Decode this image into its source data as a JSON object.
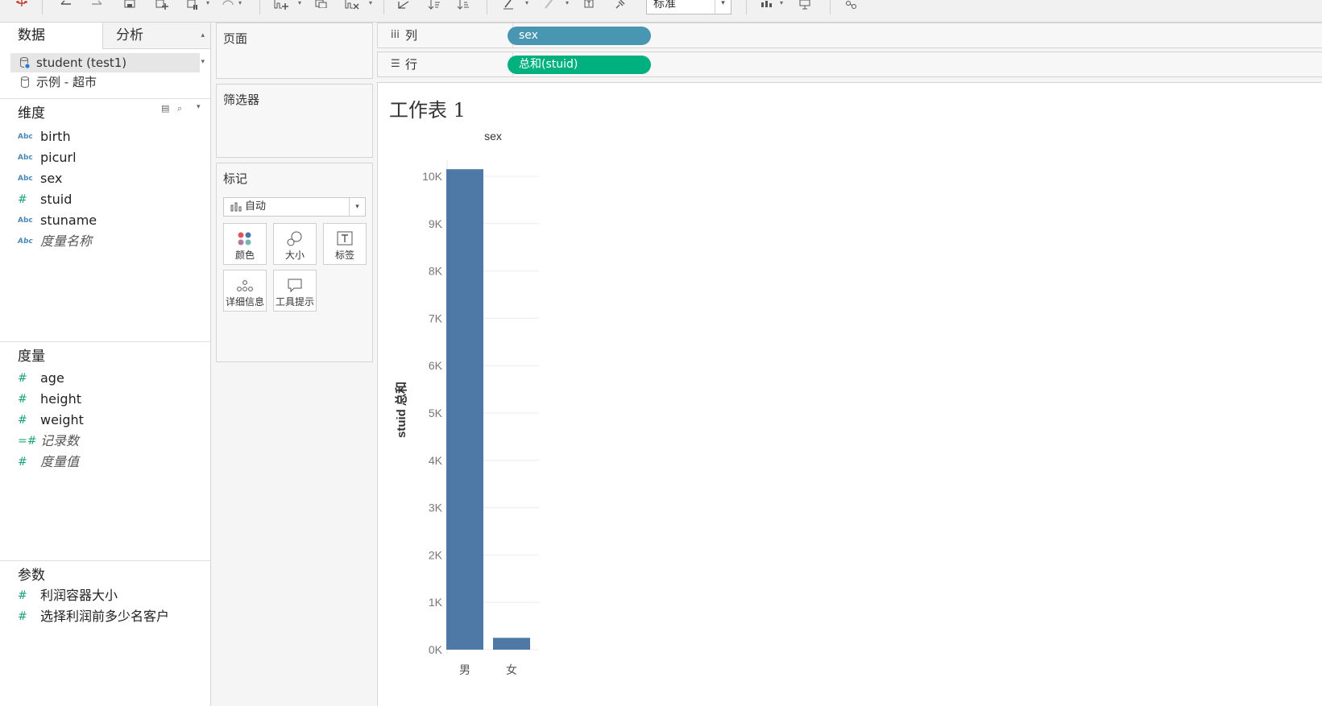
{
  "toolbar": {
    "fit_value": "标准"
  },
  "data_pane": {
    "tabs": [
      {
        "label": "数据"
      },
      {
        "label": "分析"
      }
    ],
    "data_sources": [
      {
        "label": "student (test1)",
        "selected": true
      },
      {
        "label": "示例 - 超市",
        "selected": false
      }
    ],
    "dimensions": {
      "title": "维度",
      "fields": [
        {
          "icon": "Abc",
          "label": "birth"
        },
        {
          "icon": "Abc",
          "label": "picurl"
        },
        {
          "icon": "Abc",
          "label": "sex"
        },
        {
          "icon": "#",
          "label": "stuid"
        },
        {
          "icon": "Abc",
          "label": "stuname"
        },
        {
          "icon": "Abc",
          "label": "度量名称"
        }
      ]
    },
    "measures": {
      "title": "度量",
      "fields": [
        {
          "icon": "#",
          "label": "age"
        },
        {
          "icon": "#",
          "label": "height"
        },
        {
          "icon": "#",
          "label": "weight"
        },
        {
          "icon": "=#",
          "label": "记录数"
        },
        {
          "icon": "#",
          "label": "度量值"
        }
      ]
    },
    "parameters": {
      "title": "参数",
      "fields": [
        {
          "icon": "#",
          "label": "利润容器大小"
        },
        {
          "icon": "#",
          "label": "选择利润前多少名客户"
        }
      ]
    }
  },
  "cards": {
    "pages": "页面",
    "filters": "筛选器",
    "marks": {
      "title": "标记",
      "type": "自动",
      "buttons": [
        {
          "label": "颜色"
        },
        {
          "label": "大小"
        },
        {
          "label": "标签"
        },
        {
          "label": "详细信息"
        },
        {
          "label": "工具提示"
        }
      ]
    }
  },
  "shelves": {
    "columns": {
      "label": "列",
      "pill": "sex"
    },
    "rows": {
      "label": "行",
      "pill": "总和(stuid)"
    }
  },
  "sheet": {
    "title": "工作表 1"
  },
  "colors": {
    "bar": "#4e79a7",
    "pill_dimension": "#4996b2",
    "pill_measure": "#00b180"
  },
  "chart_data": {
    "type": "bar",
    "header": "sex",
    "categories": [
      "男",
      "女"
    ],
    "values": [
      10150,
      250
    ],
    "ylabel": "stuid 总和",
    "ylim": [
      0,
      10000
    ],
    "yticks": [
      0,
      1000,
      2000,
      3000,
      4000,
      5000,
      6000,
      7000,
      8000,
      9000,
      10000
    ],
    "ytick_labels": [
      "0K",
      "1K",
      "2K",
      "3K",
      "4K",
      "5K",
      "6K",
      "7K",
      "8K",
      "9K",
      "10K"
    ],
    "grid": true
  }
}
